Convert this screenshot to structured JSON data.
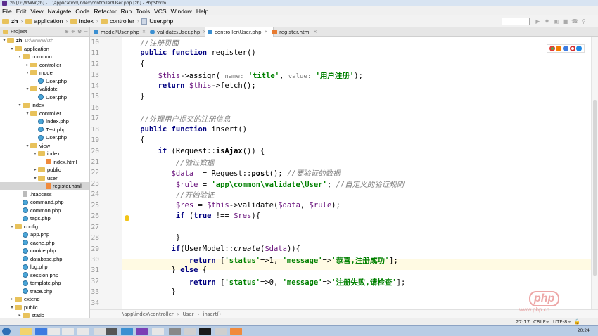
{
  "window": {
    "title": "zh [D:\\WWW\\zh] - ...\\application\\index\\controller\\User.php [zh] - PhpStorm"
  },
  "menu": [
    "File",
    "Edit",
    "View",
    "Navigate",
    "Code",
    "Refactor",
    "Run",
    "Tools",
    "VCS",
    "Window",
    "Help"
  ],
  "navbar": {
    "crumbs": [
      "zh",
      "application",
      "index",
      "controller",
      "User.php"
    ]
  },
  "project_panel": {
    "title": "Project"
  },
  "tabs": [
    {
      "label": "model\\User.php",
      "type": "php",
      "active": false
    },
    {
      "label": "validate\\User.php",
      "type": "php",
      "active": false
    },
    {
      "label": "controller\\User.php",
      "type": "php",
      "active": true
    },
    {
      "label": "register.html",
      "type": "html",
      "active": false
    }
  ],
  "tree": [
    {
      "label": "zh",
      "hint": "D:\\WWW\\zh",
      "depth": 0,
      "arrow": "down",
      "icon": "folder"
    },
    {
      "label": "application",
      "depth": 1,
      "arrow": "down",
      "icon": "folder"
    },
    {
      "label": "common",
      "depth": 2,
      "arrow": "down",
      "icon": "folder"
    },
    {
      "label": "controller",
      "depth": 3,
      "arrow": "right",
      "icon": "folder"
    },
    {
      "label": "model",
      "depth": 3,
      "arrow": "down",
      "icon": "folder"
    },
    {
      "label": "User.php",
      "depth": 4,
      "arrow": "",
      "icon": "php"
    },
    {
      "label": "validate",
      "depth": 3,
      "arrow": "down",
      "icon": "folder"
    },
    {
      "label": "User.php",
      "depth": 4,
      "arrow": "",
      "icon": "php"
    },
    {
      "label": "index",
      "depth": 2,
      "arrow": "down",
      "icon": "folder"
    },
    {
      "label": "controller",
      "depth": 3,
      "arrow": "down",
      "icon": "folder"
    },
    {
      "label": "Index.php",
      "depth": 4,
      "arrow": "",
      "icon": "php"
    },
    {
      "label": "Test.php",
      "depth": 4,
      "arrow": "",
      "icon": "php"
    },
    {
      "label": "User.php",
      "depth": 4,
      "arrow": "",
      "icon": "php"
    },
    {
      "label": "view",
      "depth": 3,
      "arrow": "down",
      "icon": "folder"
    },
    {
      "label": "index",
      "depth": 4,
      "arrow": "down",
      "icon": "folder"
    },
    {
      "label": "index.html",
      "depth": 5,
      "arrow": "",
      "icon": "html"
    },
    {
      "label": "public",
      "depth": 4,
      "arrow": "right",
      "icon": "folder"
    },
    {
      "label": "user",
      "depth": 4,
      "arrow": "down",
      "icon": "folder"
    },
    {
      "label": "register.html",
      "depth": 5,
      "arrow": "",
      "icon": "html",
      "selected": true
    },
    {
      "label": ".htaccess",
      "depth": 2,
      "arrow": "",
      "icon": "txt"
    },
    {
      "label": "command.php",
      "depth": 2,
      "arrow": "",
      "icon": "php"
    },
    {
      "label": "common.php",
      "depth": 2,
      "arrow": "",
      "icon": "php"
    },
    {
      "label": "tags.php",
      "depth": 2,
      "arrow": "",
      "icon": "php"
    },
    {
      "label": "config",
      "depth": 1,
      "arrow": "down",
      "icon": "folder"
    },
    {
      "label": "app.php",
      "depth": 2,
      "arrow": "",
      "icon": "php"
    },
    {
      "label": "cache.php",
      "depth": 2,
      "arrow": "",
      "icon": "php"
    },
    {
      "label": "cookie.php",
      "depth": 2,
      "arrow": "",
      "icon": "php"
    },
    {
      "label": "database.php",
      "depth": 2,
      "arrow": "",
      "icon": "php"
    },
    {
      "label": "log.php",
      "depth": 2,
      "arrow": "",
      "icon": "php"
    },
    {
      "label": "session.php",
      "depth": 2,
      "arrow": "",
      "icon": "php"
    },
    {
      "label": "template.php",
      "depth": 2,
      "arrow": "",
      "icon": "php"
    },
    {
      "label": "trace.php",
      "depth": 2,
      "arrow": "",
      "icon": "php"
    },
    {
      "label": "extend",
      "depth": 1,
      "arrow": "right",
      "icon": "folder"
    },
    {
      "label": "public",
      "depth": 1,
      "arrow": "down",
      "icon": "folder"
    },
    {
      "label": "static",
      "depth": 2,
      "arrow": "right",
      "icon": "folder"
    }
  ],
  "code_lines": [
    {
      "num": "10",
      "html": "    <span class='cm'>//注册页面</span>"
    },
    {
      "num": "11",
      "html": "    <span class='kw'>public function</span> register()"
    },
    {
      "num": "12",
      "html": "    {"
    },
    {
      "num": "13",
      "html": "        <span class='var'>$this</span>-&gt;assign( <span class='hint-label'>name:</span> <span class='str'>'title'</span>, <span class='hint-label'>value:</span> <span class='str'>'用户注册'</span>);"
    },
    {
      "num": "14",
      "html": "        <span class='kw'>return</span> <span class='var'>$this</span>-&gt;fetch();"
    },
    {
      "num": "15",
      "html": "    }"
    },
    {
      "num": "16",
      "html": ""
    },
    {
      "num": "17",
      "html": "    <span class='cm'>//外理用户提交的注册信息</span>"
    },
    {
      "num": "18",
      "html": "    <span class='kw'>public function</span> insert()"
    },
    {
      "num": "19",
      "html": "    {"
    },
    {
      "num": "20",
      "html": "        <span class='kw'>if</span> (Request::<b>isAjax</b>()) {"
    },
    {
      "num": "21",
      "html": "            <span class='cm'>//验证数据</span>"
    },
    {
      "num": "22",
      "html": "           <span class='var'>$data</span>  = Request::<b>post</b>(); <span class='cm'>//要验证的数据</span>"
    },
    {
      "num": "23",
      "html": "            <span class='var'>$rule</span> = <span class='str'>'app\\common\\validate\\User'</span>; <span class='cm'>//自定义的验证规则</span>"
    },
    {
      "num": "24",
      "html": "            <span class='cm'>//开始验证</span>"
    },
    {
      "num": "25",
      "html": "            <span class='var'>$res</span> = <span class='var'>$this</span>-&gt;validate(<span class='var'>$data</span>, <span class='var'>$rule</span>);"
    },
    {
      "num": "26",
      "html": "            <span class='kw'>if</span> (<span class='kw'>true</span> !== <span class='var'>$res</span>){"
    },
    {
      "num": "27",
      "html": ""
    },
    {
      "num": "28",
      "html": "            }"
    },
    {
      "num": "29",
      "html": "           <span class='kw'>if</span>(UserModel::<span class='fn-it'>create</span>(<span class='var'>$data</span>)){"
    },
    {
      "num": "30",
      "html": "               <span class='kw'>return</span> [<span class='str'>'status'</span>=&gt;1, <span class='str'>'message'</span>=&gt;<span class='str'>'恭喜,注册成功'</span>];"
    },
    {
      "num": "31",
      "html": "           } <span class='kw'>else</span> {"
    },
    {
      "num": "32",
      "html": "               <span class='kw'>return</span> [<span class='str'>'status'</span>=&gt;0, <span class='str'>'message'</span>=&gt;<span class='str'>'注册失败,请检查'</span>];"
    },
    {
      "num": "33",
      "html": "           }"
    },
    {
      "num": "34",
      "html": ""
    }
  ],
  "editor_breadcrumb": [
    "\\app\\index\\controller",
    "User",
    "insert()"
  ],
  "status": {
    "position": "27:17",
    "line_sep": "CRLF÷",
    "encoding": "UTF-8÷"
  },
  "clock": "20:24",
  "watermark": {
    "logo": "php",
    "site": "www.php.cn"
  },
  "colors": {
    "keyword": "#000080",
    "comment": "#808080",
    "string": "#008000",
    "variable": "#660e7a",
    "caret_line": "#fffae3"
  }
}
